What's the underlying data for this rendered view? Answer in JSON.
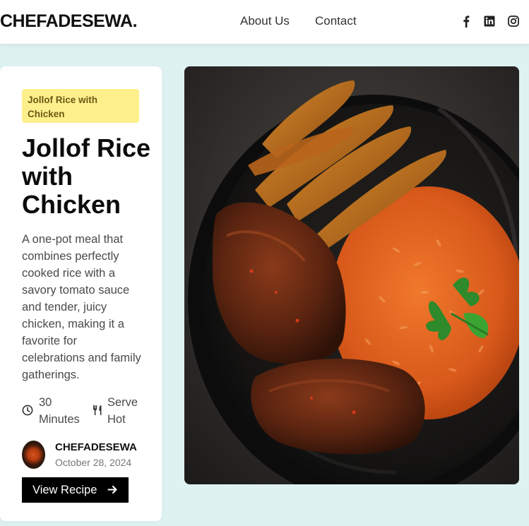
{
  "header": {
    "brand": "CHEFADESEWA.",
    "nav": [
      "About Us",
      "Contact"
    ],
    "social": [
      "facebook-icon",
      "linkedin-icon",
      "instagram-icon"
    ]
  },
  "recipe": {
    "tag": "Jollof Rice with Chicken",
    "title": "Jollof Rice with Chicken",
    "description": "A one-pot meal that combines perfectly cooked rice with a savory tomato sauce and tender, juicy chicken, making it a favorite for celebrations and family gatherings.",
    "time": "30 Minutes",
    "serve": "Serve Hot",
    "author": "CHEFADESEWA",
    "date": "October 28, 2024",
    "cta": "View Recipe"
  },
  "colors": {
    "background": "#dff2f2",
    "tag_bg": "#fdf08c",
    "button_bg": "#000000"
  },
  "image": {
    "subject": "plate of jollof rice with fried plantain and chicken"
  }
}
